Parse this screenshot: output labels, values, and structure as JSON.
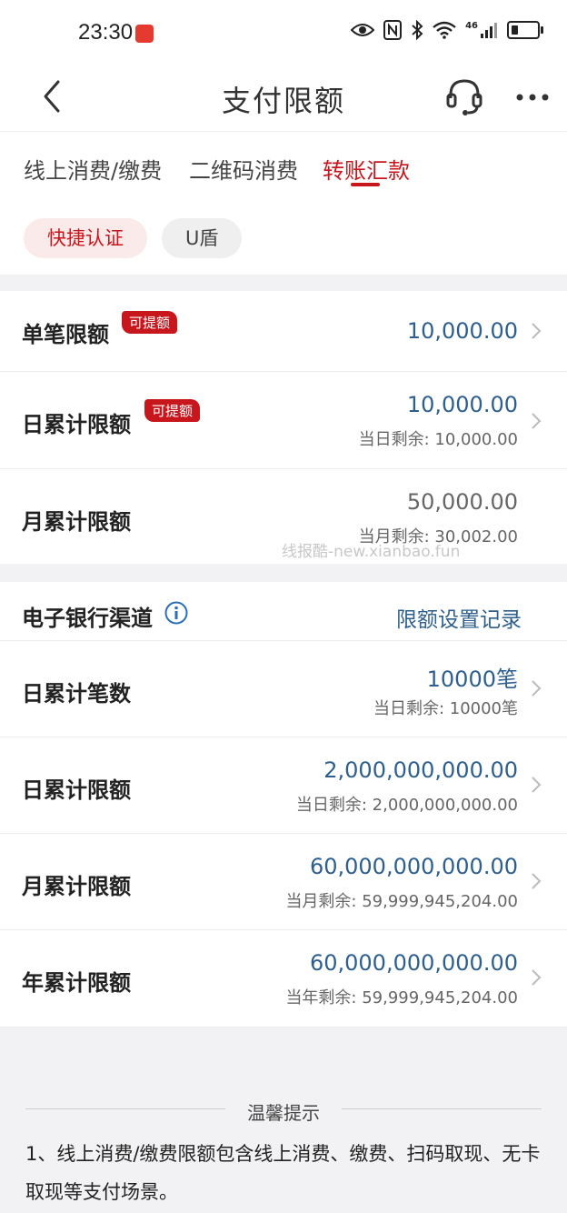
{
  "status_bar": {
    "time": "23:30",
    "network": "46"
  },
  "nav": {
    "title": "支付限额"
  },
  "tabs": [
    {
      "label": "线上消费/缴费",
      "active": false
    },
    {
      "label": "二维码消费",
      "active": false
    },
    {
      "label": "转账汇款",
      "active": true
    }
  ],
  "auth_pills": [
    {
      "label": "快捷认证",
      "active": true
    },
    {
      "label": "U盾",
      "active": false
    }
  ],
  "limits": [
    {
      "label": "单笔限额",
      "tag": "可提额",
      "value": "10,000.00",
      "sub": ""
    },
    {
      "label": "日累计限额",
      "tag": "可提额",
      "value": "10,000.00",
      "sub": "当日剩余: 10,000.00"
    },
    {
      "label": "月累计限额",
      "tag": "",
      "value": "50,000.00",
      "sub": "当月剩余: 30,002.00"
    }
  ],
  "watermark": "线报酷-new.xianbao.fun",
  "channel": {
    "title": "电子银行渠道",
    "link": "限额设置记录",
    "rows": [
      {
        "label": "日累计笔数",
        "value": "10000笔",
        "sub": "当日剩余: 10000笔"
      },
      {
        "label": "日累计限额",
        "value": "2,000,000,000.00",
        "sub": "当日剩余: 2,000,000,000.00"
      },
      {
        "label": "月累计限额",
        "value": "60,000,000,000.00",
        "sub": "当月剩余: 59,999,945,204.00"
      },
      {
        "label": "年累计限额",
        "value": "60,000,000,000.00",
        "sub": "当年剩余: 59,999,945,204.00"
      }
    ]
  },
  "tips": {
    "title": "温馨提示",
    "text": "1、线上消费/缴费限额包含线上消费、缴费、扫码取现、无卡取现等支付场景。"
  },
  "colors": {
    "accent_red": "#c8161d",
    "link_blue": "#2e5f8e"
  }
}
